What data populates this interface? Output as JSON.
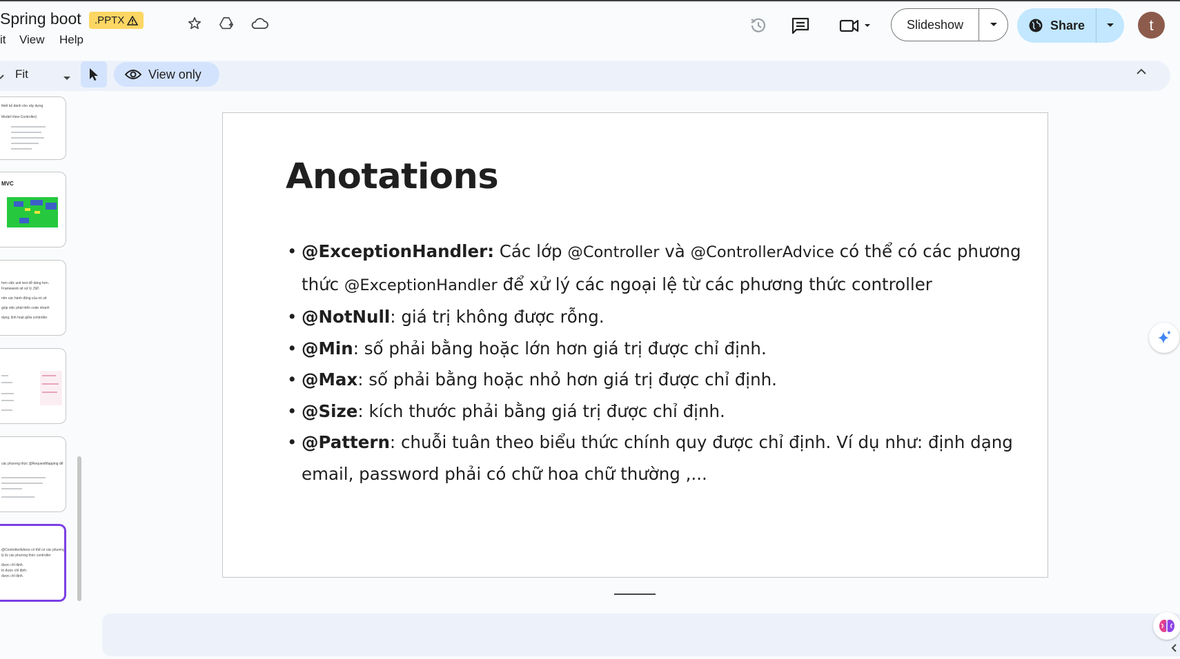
{
  "header": {
    "doc_title": "Spring boot",
    "file_badge": ".PPTX",
    "menu": [
      "it",
      "View",
      "Help"
    ],
    "slideshow_label": "Slideshow",
    "share_label": "Share",
    "avatar_letter": "t"
  },
  "toolbar": {
    "zoom_value": "Fit",
    "view_mode_label": "View only"
  },
  "filmstrip": {
    "thumbnails": [
      {
        "lines": [
          "thiết kế dành cho xây dựng",
          "Model-View-Controller)"
        ]
      },
      {
        "lines": [
          "MVC"
        ]
      },
      {
        "lines": [
          "hơn việc unit test dễ dàng hơn.",
          "Framework sẽ xử lý JSP,",
          "nên các hành động của nó sẽ",
          "giúp việc phát triển code nhanh",
          "dụng, linh hoạt giữa controller."
        ]
      },
      {
        "lines": []
      },
      {
        "lines": [
          "các phương thức @RequestMapping để"
        ]
      },
      {
        "lines": [
          "@ControllerAdvice có thể có các phương",
          "lý từ các phương thức controller",
          "được chỉ định.",
          "trị được chỉ định.",
          "được chỉ định."
        ]
      }
    ]
  },
  "slide": {
    "title": "Anotations",
    "bullets": [
      {
        "bold": "@ExceptionHandler:",
        "text1": " Các lớp ",
        "code1": "@Controller",
        "text2": " và ",
        "code2": "@ControllerAdvice",
        "text3": " có thể có các phương",
        "line2a": "thức ",
        "code3": "@ExceptionHandler",
        "line2b": " để xử lý các ngoại lệ từ các phương thức controller"
      },
      {
        "bold": "@NotNull",
        "text": ": giá trị không được rỗng."
      },
      {
        "bold": "@Min",
        "text": ": số phải bằng hoặc lớn hơn giá trị được chỉ định."
      },
      {
        "bold": "@Max",
        "text": ": số phải bằng hoặc nhỏ hơn giá trị được chỉ định."
      },
      {
        "bold": "@Size",
        "text": ": kích thước phải bằng giá trị được chỉ định."
      },
      {
        "bold": "@Pattern",
        "text": ": chuỗi tuân theo biểu thức chính quy được chỉ định. Ví dụ như: định dạng email, password phải có chữ hoa chữ thường ,..."
      }
    ]
  },
  "colors": {
    "accent_blue": "#c2e7ff",
    "active_thumb_border": "#7b3fe4",
    "warning_badge": "#fdd663"
  }
}
